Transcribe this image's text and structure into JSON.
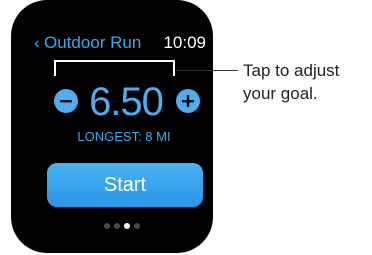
{
  "watch": {
    "header": {
      "back_glyph": "‹",
      "title": "Outdoor Run",
      "time": "10:09"
    },
    "goal": {
      "value": "6.50",
      "decrement_icon": "minus-icon",
      "increment_icon": "plus-icon"
    },
    "longest_label": "LONGEST: 8 MI",
    "start_label": "Start",
    "pagination": {
      "count": 4,
      "active_index": 2
    }
  },
  "callout": {
    "line1": "Tap to adjust",
    "line2": "your goal."
  },
  "colors": {
    "accent": "#4aaef0",
    "watch_bg": "#000000",
    "button": "#2a96e6"
  }
}
